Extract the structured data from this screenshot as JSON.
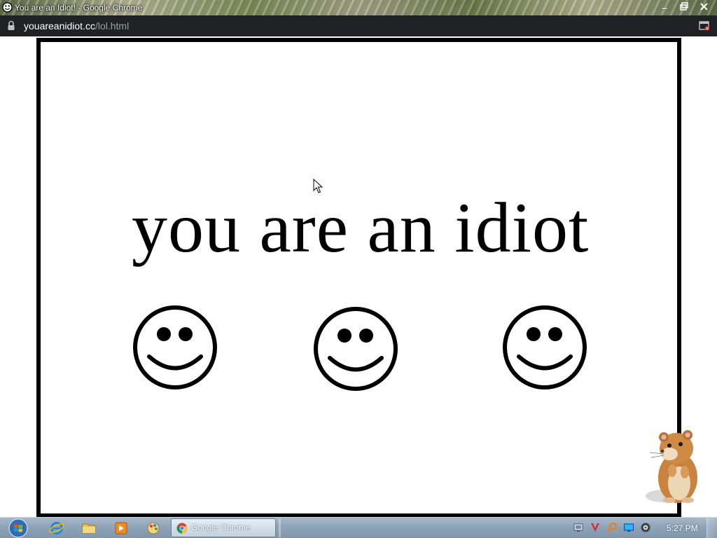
{
  "window": {
    "title": "You are an Idiot! - Google Chrome"
  },
  "address_bar": {
    "host": "youareanidiot.cc",
    "path": "/lol.html"
  },
  "page": {
    "headline": "you are an idiot"
  },
  "taskbar": {
    "active_task_label": "Google Chrome",
    "clock": "5:27 PM"
  },
  "colors": {
    "address_bar_bg": "#202124",
    "frame_border": "#000000",
    "url_path": "#9aa0a6"
  },
  "icons": {
    "title_favicon": "smiley-icon",
    "lock": "lock-icon",
    "popup": "popup-blocked-icon",
    "pinned": [
      "internet-explorer-icon",
      "folder-icon",
      "media-player-icon",
      "paint-icon"
    ],
    "tray": [
      "network-icon",
      "antivirus-icon",
      "search-icon",
      "monitor-icon",
      "webcam-icon"
    ]
  }
}
